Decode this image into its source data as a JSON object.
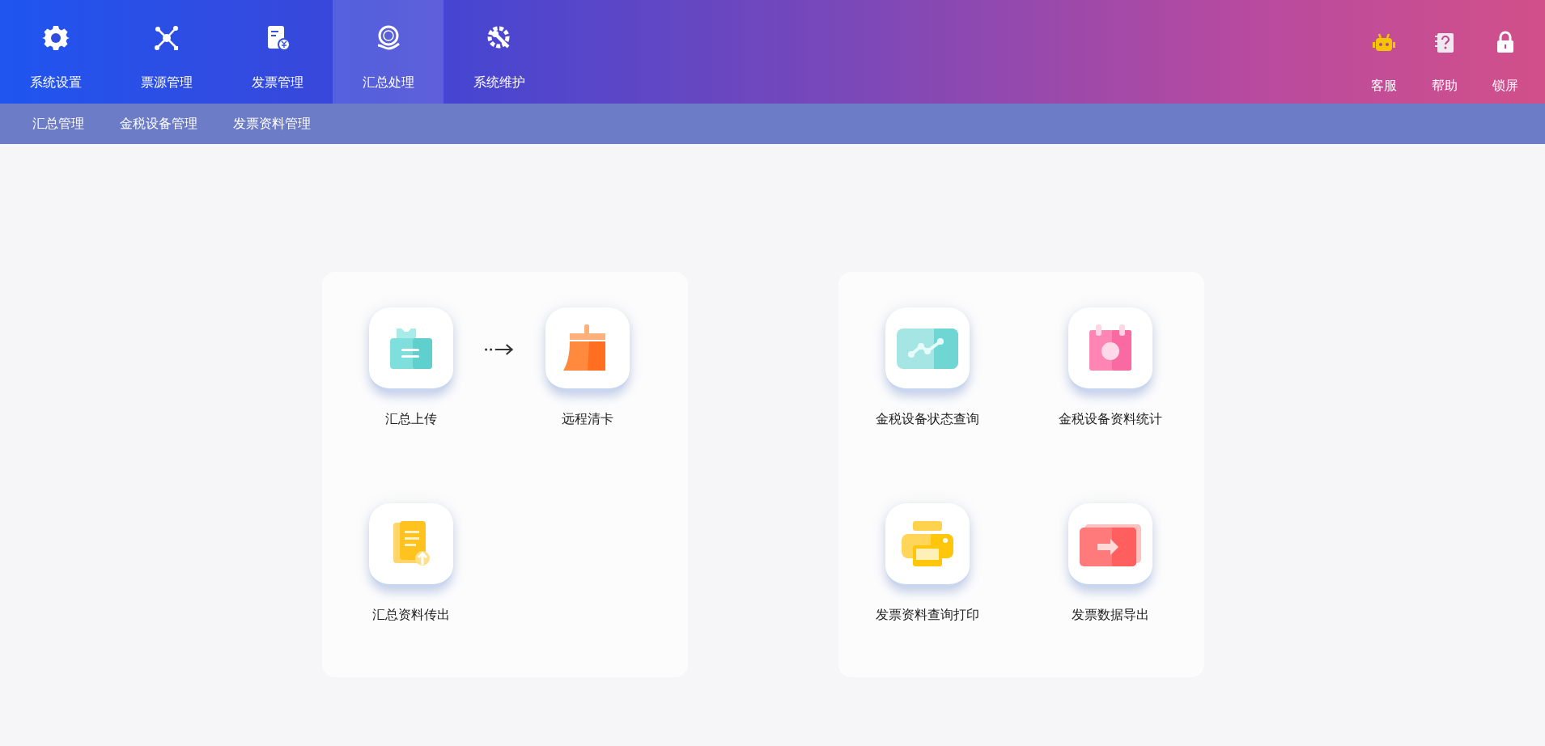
{
  "nav_tabs": [
    {
      "label": "系统设置",
      "selected": false
    },
    {
      "label": "票源管理",
      "selected": false
    },
    {
      "label": "发票管理",
      "selected": false
    },
    {
      "label": "汇总处理",
      "selected": true
    },
    {
      "label": "系统维护",
      "selected": false
    }
  ],
  "header_actions": [
    {
      "label": "客服"
    },
    {
      "label": "帮助"
    },
    {
      "label": "锁屏"
    }
  ],
  "sub_nav": [
    {
      "label": "汇总管理"
    },
    {
      "label": "金税设备管理"
    },
    {
      "label": "发票资料管理"
    }
  ],
  "panels": [
    {
      "rows": [
        [
          {
            "kind": "tile",
            "label": "汇总上传"
          },
          {
            "kind": "arrow"
          },
          {
            "kind": "tile",
            "label": "远程清卡"
          }
        ],
        [
          {
            "kind": "tile",
            "label": "汇总资料传出"
          }
        ]
      ]
    },
    {
      "rows": [
        [
          {
            "kind": "tile",
            "label": "金税设备状态查询"
          },
          {
            "kind": "tile",
            "label": "金税设备资料统计"
          }
        ],
        [
          {
            "kind": "tile",
            "label": "发票资料查询打印"
          },
          {
            "kind": "tile",
            "label": "发票数据导出"
          }
        ]
      ]
    }
  ]
}
